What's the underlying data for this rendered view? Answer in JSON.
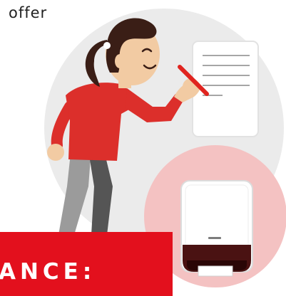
{
  "caption": "offer",
  "banner": {
    "text": "ANCE:"
  },
  "colors": {
    "accent_red": "#e3101d",
    "shirt_red": "#dc2f2b",
    "circle_grey": "#ebebeb",
    "circle_pink": "#f4c2c2",
    "skin": "#f2cba3",
    "hair": "#3a1e16",
    "pants_light": "#9b9b9b",
    "pants_dark": "#555555"
  },
  "icons": [
    "document-icon",
    "pencil-icon",
    "mobile-device-icon"
  ]
}
